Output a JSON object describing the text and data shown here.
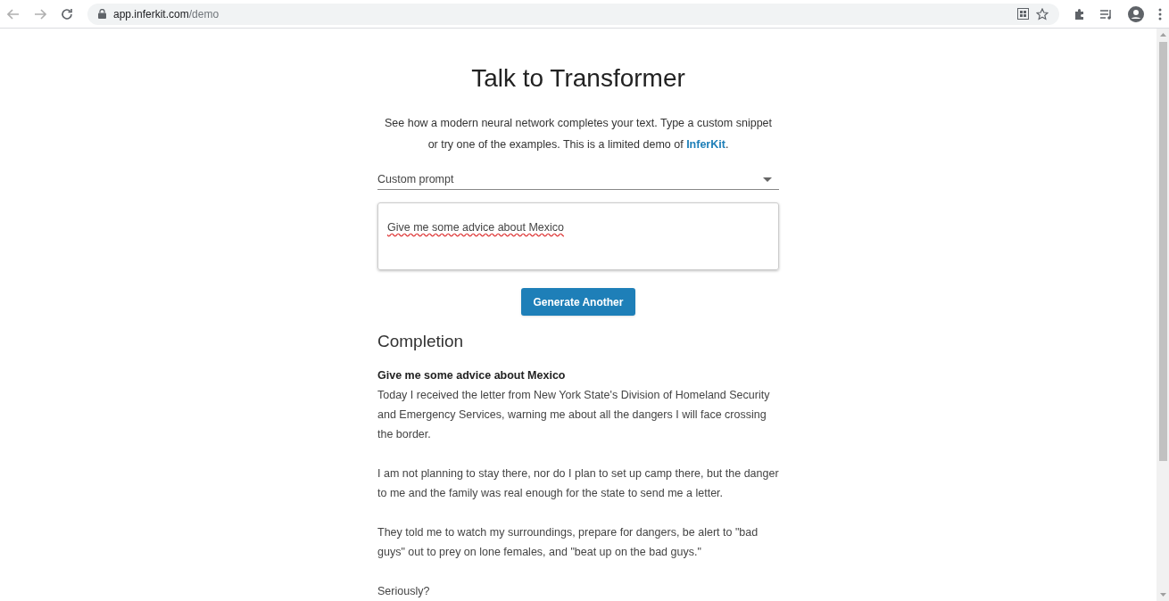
{
  "browser": {
    "url_host": "app.inferkit.com",
    "url_path": "/demo"
  },
  "title": "Talk to Transformer",
  "description": {
    "before": "See how a modern neural network completes your text. Type a custom snippet or try one of the examples. This is a limited demo of ",
    "link": "InferKit",
    "after": "."
  },
  "prompt_select": {
    "value": "Custom prompt"
  },
  "prompt_input": {
    "value": "Give me some advice about Mexico"
  },
  "generate_button": "Generate Another",
  "completion": {
    "heading": "Completion",
    "prompt": "Give me some advice about Mexico",
    "paragraphs": [
      "Today I received the letter from New York State's Division of Homeland Security and Emergency Services, warning me about all the dangers I will face crossing the border.",
      "I am not planning to stay there, nor do I plan to set up camp there, but the danger to me and the family was real enough for the state to send me a letter.",
      "They told me to watch my surroundings, prepare for dangers, be alert to \"bad guys\" out to prey on lone females, and \"beat up on the bad guys.\"",
      "Seriously?"
    ]
  }
}
